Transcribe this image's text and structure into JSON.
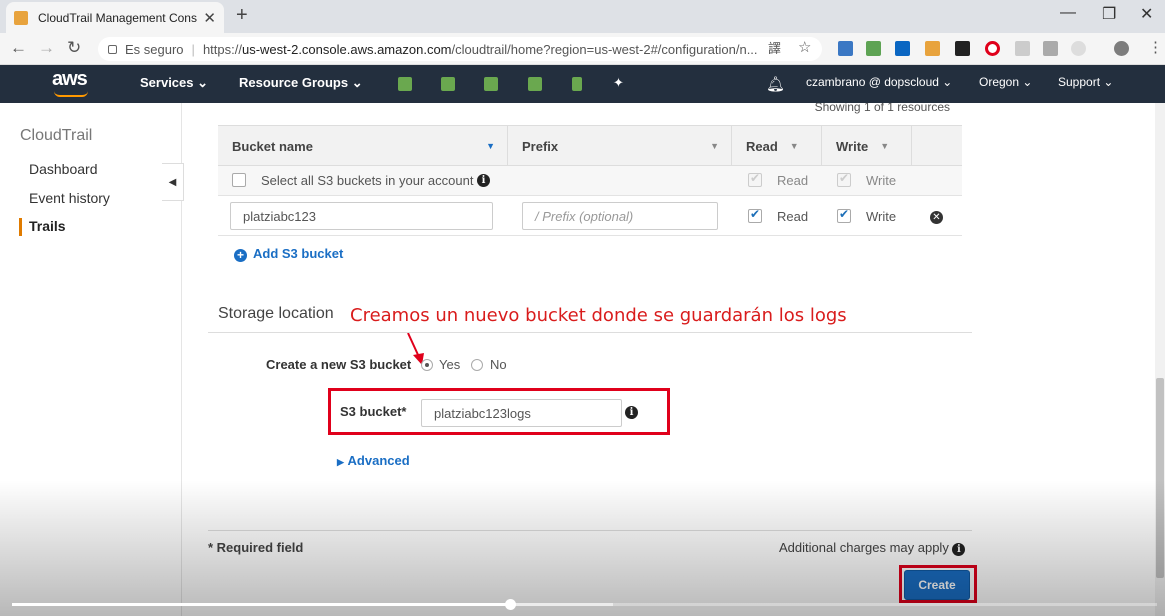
{
  "browser": {
    "tab_title": "CloudTrail Management Console",
    "tab_close": "✕",
    "new_tab": "+",
    "win_minimize": "—",
    "win_restore": "❐",
    "win_close": "✕",
    "secure_label": "Es seguro",
    "url_prefix": "https://",
    "url_host": "us-west-2.console.aws.amazon.com",
    "url_rest": "/cloudtrail/home?region=us-west-2#/configuration/n..."
  },
  "aws_nav": {
    "logo": "aws",
    "services": "Services ⌄",
    "resource_groups": "Resource Groups ⌄",
    "account": "czambrano @ dopscloud ⌄",
    "region": "Oregon ⌄",
    "support": "Support ⌄"
  },
  "sidebar": {
    "title": "CloudTrail",
    "items": [
      {
        "label": "Dashboard"
      },
      {
        "label": "Event history"
      },
      {
        "label": "Trails"
      }
    ]
  },
  "buckets_table": {
    "showing": "Showing 1 of 1 resources",
    "headers": {
      "bucket_name": "Bucket name",
      "prefix": "Prefix",
      "read": "Read",
      "write": "Write"
    },
    "select_all_label": "Select all S3 buckets in your account",
    "read_label": "Read",
    "write_label": "Write",
    "row_bucket": "platziabc123",
    "prefix_placeholder": "/ Prefix (optional)",
    "add_bucket": "Add S3 bucket"
  },
  "storage": {
    "title": "Storage location",
    "annotation": "Creamos un nuevo bucket donde se guardarán los logs",
    "create_new_label": "Create a new S3 bucket",
    "yes": "Yes",
    "no": "No",
    "bucket_label": "S3 bucket*",
    "bucket_value": "platziabc123logs",
    "advanced": "Advanced"
  },
  "footer": {
    "required": "* Required field",
    "charges": "Additional charges may apply",
    "create": "Create"
  },
  "video": {
    "played_fraction": 0.435,
    "buffered_fraction": 0.525
  },
  "colors": {
    "aws_nav_bg": "#232f3e",
    "accent_orange": "#ff9900",
    "link_blue": "#1a6ec4",
    "annotation_red": "#d91c1c"
  }
}
